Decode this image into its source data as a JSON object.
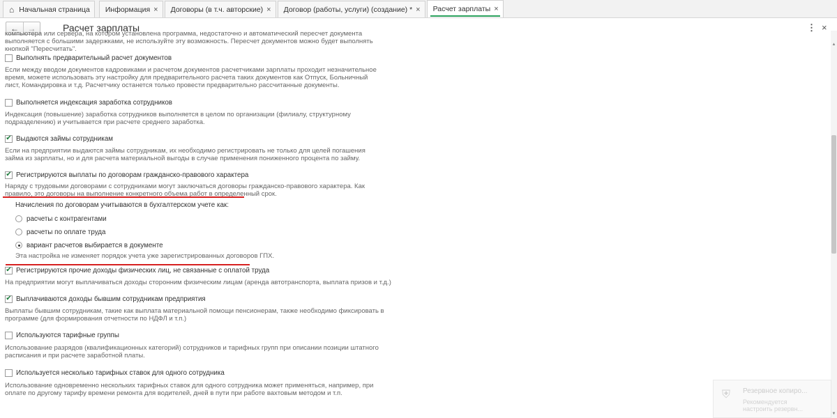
{
  "tabs": [
    {
      "label": "Начальная страница",
      "home": true,
      "closable": false,
      "active": false
    },
    {
      "label": "Информация",
      "home": false,
      "closable": true,
      "active": false
    },
    {
      "label": "Договоры (в т.ч. авторские)",
      "home": false,
      "closable": true,
      "active": false
    },
    {
      "label": "Договор (работы, услуги) (создание) *",
      "home": false,
      "closable": true,
      "active": false
    },
    {
      "label": "Расчет зарплаты",
      "home": false,
      "closable": true,
      "active": true
    }
  ],
  "header": {
    "back_icon": "←",
    "forward_icon": "→",
    "title": "Расчет зарплаты",
    "more_icon": "⋮",
    "close_icon": "×"
  },
  "content": {
    "intro_desc": "компьютера или сервера, на котором установлена программа, недостаточно и автоматический пересчет документа\nвыполняется с большими задержками, не используйте эту возможность. Пересчет документов можно будет выполнять\nкнопкой \"Пересчитать\".",
    "options": [
      {
        "id": "precalc",
        "label": "Выполнять предварительный расчет документов",
        "checked": false,
        "desc": "Если между вводом документов кадровиками и расчетом документов расчетчиками зарплаты проходит незначительное\nвремя, можете использовать эту настройку для предварительного расчета таких документов как Отпуск, Больничный\nлист, Командировка и т.д. Расчетчику останется только провести предварительно рассчитанные документы."
      },
      {
        "id": "indexation",
        "label": "Выполняется индексация заработка сотрудников",
        "checked": false,
        "desc": "Индексация (повышение) заработка сотрудников выполняется в целом по организации (филиалу, структурному\nподразделению) и учитывается при расчете среднего заработка."
      },
      {
        "id": "loans",
        "label": "Выдаются займы сотрудникам",
        "checked": true,
        "desc": "Если на предприятии выдаются займы сотрудникам, их необходимо регистрировать не только для целей погашения\nзайма из зарплаты, но и для расчета материальной выгоды в случае применения пониженного процента по займу."
      },
      {
        "id": "gph",
        "label": "Регистрируются выплаты по договорам гражданско-правового характера",
        "checked": true,
        "desc": "Наряду с трудовыми договорами с сотрудниками могут заключаться договоры гражданско-правового характера. Как\nправило, это договоры на выполнение конкретного объема работ в определенный срок."
      }
    ],
    "gph_sub": {
      "label": "Начисления по договорам учитываются в бухгалтерском учете как:",
      "radios": [
        {
          "label": "расчеты с контрагентами",
          "selected": false
        },
        {
          "label": "расчеты по оплате труда",
          "selected": false
        },
        {
          "label": "вариант расчетов выбирается в документе",
          "selected": true
        }
      ],
      "note": "Эта настройка не изменяет порядок учета уже зарегистрированных договоров ГПХ."
    },
    "options2": [
      {
        "id": "other_income",
        "label": "Регистрируются прочие доходы физических лиц, не связанные с оплатой труда",
        "checked": true,
        "desc": "На предприятии могут выплачиваться доходы сторонним физическим лицам (аренда автотранспорта, выплата призов и т.д.)"
      },
      {
        "id": "former",
        "label": "Выплачиваются доходы бывшим сотрудникам предприятия",
        "checked": true,
        "desc": "Выплаты бывшим сотрудникам, такие как выплата материальной помощи пенсионерам, также необходимо фиксировать в\nпрограмме (для формирования отчетности по НДФЛ и т.п.)"
      },
      {
        "id": "tariff_groups",
        "label": "Используются тарифные группы",
        "checked": false,
        "desc": "Использование разрядов (квалификационных категорий) сотрудников и тарифных групп при описании позиции штатного\nрасписания и при расчете заработной платы."
      },
      {
        "id": "multi_rates",
        "label": "Используется несколько тарифных ставок для одного сотрудника",
        "checked": false,
        "desc": "Использование одновременно нескольких тарифных ставок для одного сотрудника может применяться, например, при\nоплате по другому тарифу времени ремонта для водителей, дней в пути при работе вахтовым методом и т.п."
      }
    ],
    "check_glyph": "✔"
  },
  "toast": {
    "title": "Резервное копиро...",
    "text": "Рекомендуется\nнастроить резервн...",
    "icon": "shield-icon"
  },
  "colors": {
    "accent_green": "#29a05b",
    "check_green": "#1a7a3a",
    "highlight_red": "#d62020"
  }
}
